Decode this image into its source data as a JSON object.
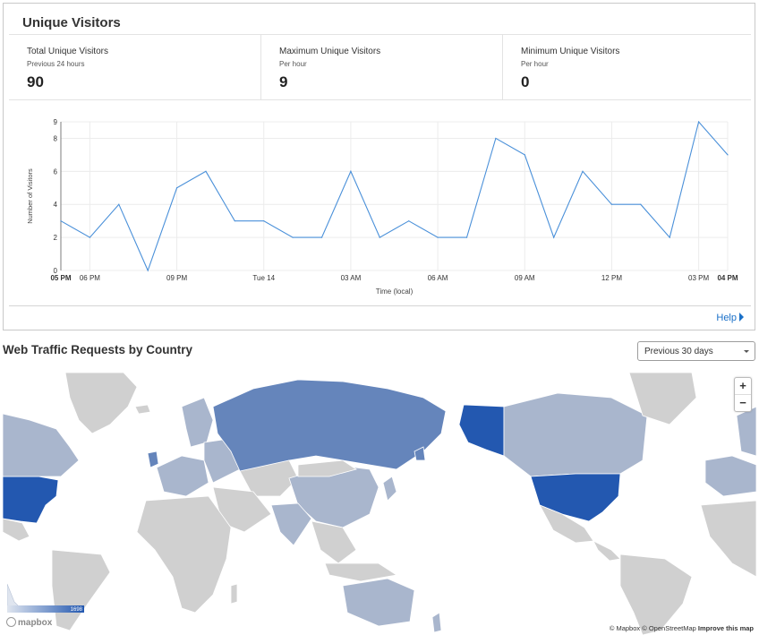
{
  "panel": {
    "title": "Unique Visitors"
  },
  "stats": [
    {
      "label": "Total Unique Visitors",
      "sublabel": "Previous 24 hours",
      "value": "90"
    },
    {
      "label": "Maximum Unique Visitors",
      "sublabel": "Per hour",
      "value": "9"
    },
    {
      "label": "Minimum Unique Visitors",
      "sublabel": "Per hour",
      "value": "0"
    }
  ],
  "chart_data": {
    "type": "line",
    "title": "",
    "xlabel": "Time (local)",
    "ylabel": "Number of Visitors",
    "ylim": [
      0,
      9
    ],
    "yticks": [
      0,
      2,
      4,
      6,
      8,
      9
    ],
    "x_tick_labels": [
      {
        "label": "05 PM",
        "i": 0,
        "bold": true
      },
      {
        "label": "06 PM",
        "i": 1,
        "bold": false
      },
      {
        "label": "09 PM",
        "i": 4,
        "bold": false
      },
      {
        "label": "Tue 14",
        "i": 7,
        "bold": false
      },
      {
        "label": "03 AM",
        "i": 10,
        "bold": false
      },
      {
        "label": "06 AM",
        "i": 13,
        "bold": false
      },
      {
        "label": "09 AM",
        "i": 16,
        "bold": false
      },
      {
        "label": "12 PM",
        "i": 19,
        "bold": false
      },
      {
        "label": "03 PM",
        "i": 22,
        "bold": false
      },
      {
        "label": "04 PM",
        "i": 23,
        "bold": true
      }
    ],
    "series": [
      {
        "values": [
          3,
          2,
          4,
          0,
          5,
          6,
          3,
          3,
          2,
          2,
          6,
          2,
          3,
          2,
          2,
          8,
          7,
          2,
          6,
          4,
          4,
          2,
          9,
          7
        ]
      }
    ],
    "grid": true,
    "line_color": "#4a90d9"
  },
  "help": {
    "label": "Help"
  },
  "traffic": {
    "title": "Web Traffic Requests by Country",
    "range_select": "Previous 30 days"
  },
  "map": {
    "zoom_in": "+",
    "zoom_out": "−",
    "legend_max": "1698",
    "logo": "mapbox",
    "attribution": "© Mapbox © OpenStreetMap",
    "improve": "Improve this map",
    "colors": {
      "high": "#2358b0",
      "medium": "#6585bb",
      "low": "#a9b6cd",
      "none": "#d0d0d0",
      "border": "#ffffff"
    }
  }
}
